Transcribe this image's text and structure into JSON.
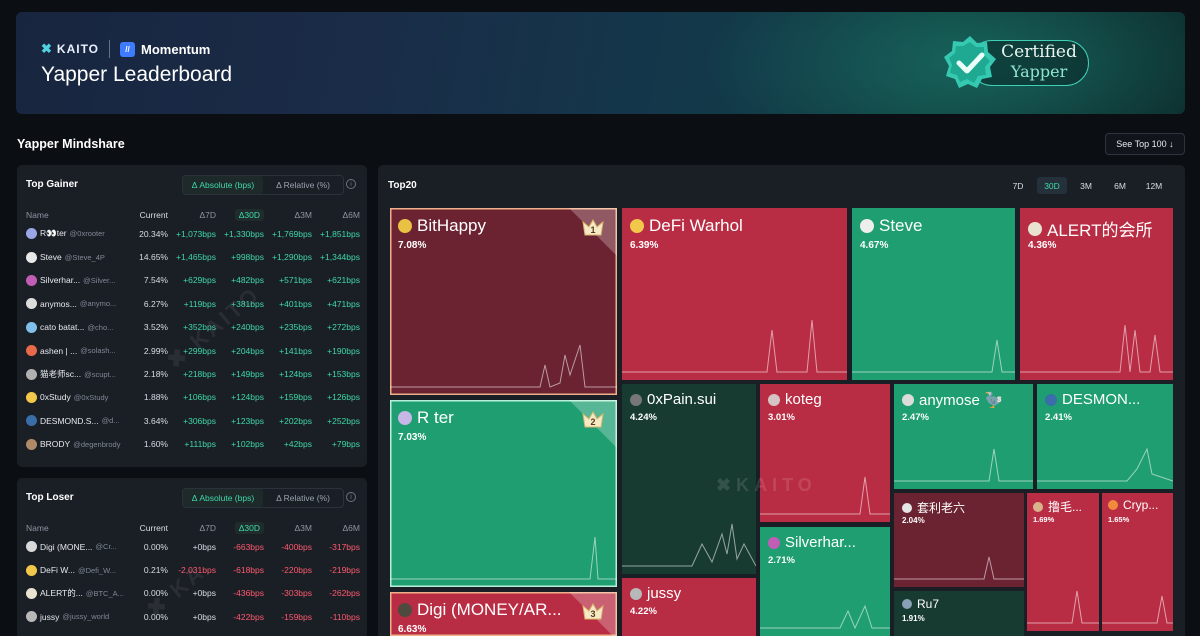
{
  "banner": {
    "kaito_label": "KAITO",
    "momentum_label": "Momentum",
    "title": "Yapper Leaderboard",
    "cert_line1": "Certified",
    "cert_line2": "Yapper"
  },
  "section": {
    "title": "Yapper Mindshare",
    "see_top": "See Top 100 ↓"
  },
  "columns": {
    "name": "Name",
    "current": "Current",
    "d7": "Δ7D",
    "d30": "Δ30D",
    "d3m": "Δ3M",
    "d6m": "Δ6M"
  },
  "toggle": {
    "absolute": "Δ Absolute (bps)",
    "relative": "Δ Relative (%)",
    "info": "i"
  },
  "gainers": {
    "title": "Top Gainer",
    "rows": [
      {
        "name": "R👀ter",
        "handle": "@0xrooter",
        "current": "20.34%",
        "d7": "+1,073bps",
        "d30": "+1,330bps",
        "d3m": "+1,769bps",
        "d6m": "+1,851bps",
        "color": "#9aa7e6"
      },
      {
        "name": "Steve",
        "handle": "@Steve_4P",
        "current": "14.65%",
        "d7": "+1,465bps",
        "d30": "+998bps",
        "d3m": "+1,290bps",
        "d6m": "+1,344bps",
        "color": "#e8e8e8"
      },
      {
        "name": "Silverhar...",
        "handle": "@Silver...",
        "current": "7.54%",
        "d7": "+629bps",
        "d30": "+482bps",
        "d3m": "+571bps",
        "d6m": "+621bps",
        "color": "#c25db5"
      },
      {
        "name": "anymos...",
        "handle": "@anymo...",
        "current": "6.27%",
        "d7": "+119bps",
        "d30": "+381bps",
        "d3m": "+401bps",
        "d6m": "+471bps",
        "color": "#dcdcdc"
      },
      {
        "name": "cato batat...",
        "handle": "@cho...",
        "current": "3.52%",
        "d7": "+352bps",
        "d30": "+240bps",
        "d3m": "+235bps",
        "d6m": "+272bps",
        "color": "#7fbfe8"
      },
      {
        "name": "ashen | ...",
        "handle": "@solash...",
        "current": "2.99%",
        "d7": "+299bps",
        "d30": "+204bps",
        "d3m": "+141bps",
        "d6m": "+190bps",
        "color": "#e86a4a"
      },
      {
        "name": "猫老师sc...",
        "handle": "@scupt...",
        "current": "2.18%",
        "d7": "+218bps",
        "d30": "+149bps",
        "d3m": "+124bps",
        "d6m": "+153bps",
        "color": "#b0b0b0"
      },
      {
        "name": "0xStudy",
        "handle": "@0xStudy",
        "current": "1.88%",
        "d7": "+106bps",
        "d30": "+124bps",
        "d3m": "+159bps",
        "d6m": "+126bps",
        "color": "#f2c84b"
      },
      {
        "name": "DESMOND.S...",
        "handle": "@d...",
        "current": "3.64%",
        "d7": "+306bps",
        "d30": "+123bps",
        "d3m": "+202bps",
        "d6m": "+252bps",
        "color": "#3a6ea8"
      },
      {
        "name": "BRODY",
        "handle": "@degenbrody",
        "current": "1.60%",
        "d7": "+111bps",
        "d30": "+102bps",
        "d3m": "+42bps",
        "d6m": "+79bps",
        "color": "#b08a68"
      }
    ]
  },
  "losers": {
    "title": "Top Loser",
    "rows": [
      {
        "name": "Digi (MONE...",
        "handle": "@Cr...",
        "current": "0.00%",
        "d7": "+0bps",
        "d30": "-663bps",
        "d3m": "-400bps",
        "d6m": "-317bps",
        "color": "#d8d8d8",
        "d7zero": true
      },
      {
        "name": "DeFi W...",
        "handle": "@Defi_W...",
        "current": "0.21%",
        "d7": "-2,031bps",
        "d30": "-618bps",
        "d3m": "-220bps",
        "d6m": "-219bps",
        "color": "#f2c84b",
        "d7zero": false
      },
      {
        "name": "ALERT的...",
        "handle": "@BTC_A...",
        "current": "0.00%",
        "d7": "+0bps",
        "d30": "-436bps",
        "d3m": "-303bps",
        "d6m": "-262bps",
        "color": "#e9e2d0",
        "d7zero": true
      },
      {
        "name": "jussy",
        "handle": "@jussy_world",
        "current": "0.00%",
        "d7": "+0bps",
        "d30": "-422bps",
        "d3m": "-159bps",
        "d6m": "-110bps",
        "color": "#b8b8b8",
        "d7zero": true
      }
    ]
  },
  "top20": {
    "title": "Top20",
    "periods": [
      "7D",
      "30D",
      "3M",
      "6M",
      "12M"
    ],
    "active_period": "30D",
    "watermark": "KAITO",
    "tiles": [
      {
        "name": "BitHappy",
        "pct": "7.08%",
        "rank": "1"
      },
      {
        "name": "R  ter",
        "pct": "7.03%",
        "rank": "2"
      },
      {
        "name": "Digi (MONEY/AR...",
        "pct": "6.63%",
        "rank": "3"
      },
      {
        "name": "DeFi Warhol",
        "pct": "6.39%"
      },
      {
        "name": "Steve",
        "pct": "4.67%"
      },
      {
        "name": "ALERT的会所",
        "pct": "4.36%"
      },
      {
        "name": "0xPain.sui",
        "pct": "4.24%"
      },
      {
        "name": "koteg",
        "pct": "3.01%"
      },
      {
        "name": "anymose 🦤",
        "pct": "2.47%"
      },
      {
        "name": "DESMON...",
        "pct": "2.41%"
      },
      {
        "name": "Silverhar...",
        "pct": "2.71%"
      },
      {
        "name": "jussy",
        "pct": "4.22%"
      },
      {
        "name": "套利老六",
        "pct": "2.04%"
      },
      {
        "name": "撸毛...",
        "pct": "1.69%"
      },
      {
        "name": "Cryp...",
        "pct": "1.65%"
      },
      {
        "name": "Ru7",
        "pct": "1.91%"
      }
    ]
  },
  "colors": {
    "accent": "#3fd9a7",
    "up": "#3fd9a7",
    "down": "#ff5a6e",
    "tile_red": "#b92d44",
    "tile_green": "#1f9e72"
  }
}
